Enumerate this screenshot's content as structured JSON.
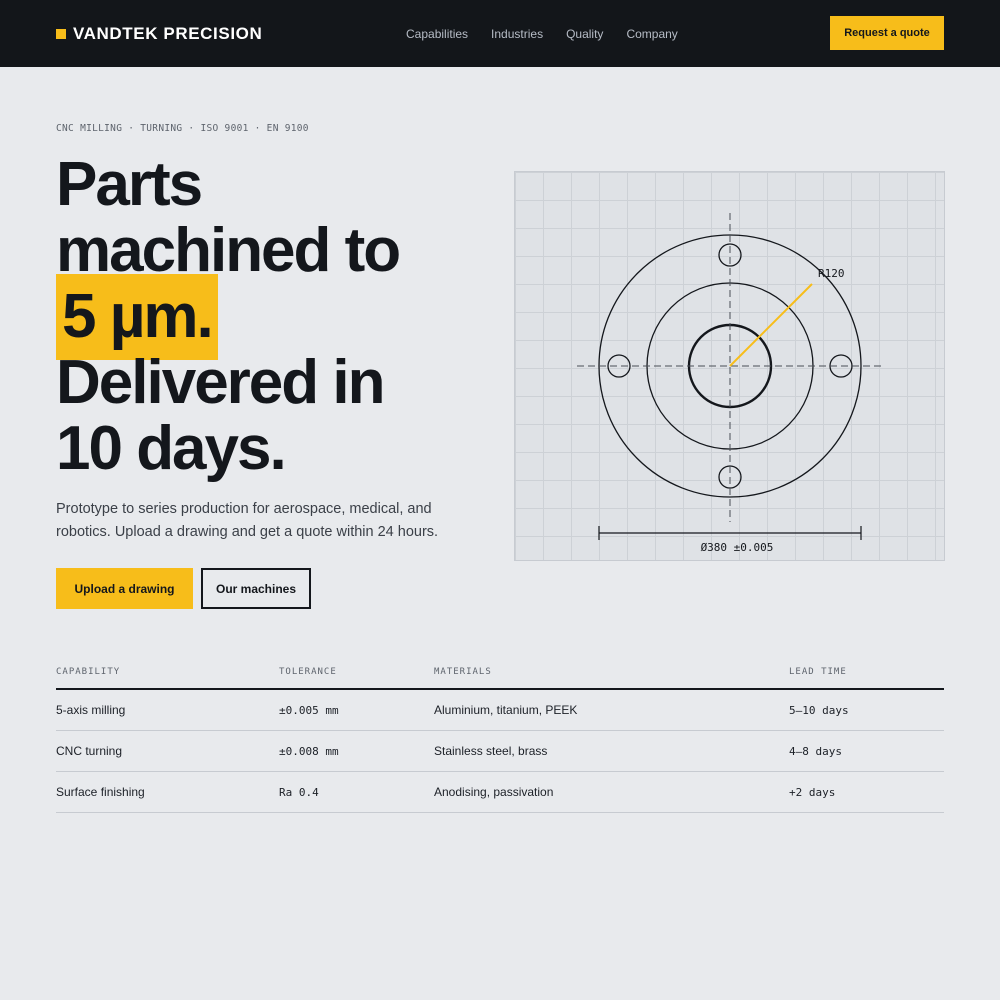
{
  "header": {
    "brand": "VANDTEK PRECISION",
    "nav": [
      "Capabilities",
      "Industries",
      "Quality",
      "Company"
    ],
    "cta": "Request a quote"
  },
  "hero": {
    "eyebrow": "CNC MILLING · TURNING · ISO 9001 · EN 9100",
    "headline": {
      "line1": "Parts",
      "line2": "machined to",
      "highlight": "5 µm.",
      "line4": "Delivered in",
      "line5": "10 days."
    },
    "lede": "Prototype to series production for aerospace, medical, and robotics. Upload a drawing and get a quote within 24 hours.",
    "primary_button": "Upload a drawing",
    "secondary_button": "Our machines"
  },
  "drawing": {
    "radius_label": "R120",
    "diameter_label": "Ø380 ±0.005",
    "accent_color": "#f7bd1a"
  },
  "specs": {
    "columns": [
      "CAPABILITY",
      "TOLERANCE",
      "MATERIALS",
      "LEAD TIME"
    ],
    "rows": [
      [
        "5-axis milling",
        "±0.005 mm",
        "Aluminium, titanium, PEEK",
        "5–10 days"
      ],
      [
        "CNC turning",
        "±0.008 mm",
        "Stainless steel, brass",
        "4–8 days"
      ],
      [
        "Surface finishing",
        "Ra 0.4",
        "Anodising, passivation",
        "+2 days"
      ]
    ]
  },
  "colors": {
    "accent": "#f7bd1a",
    "dark": "#13161a",
    "background": "#e8eaed"
  }
}
